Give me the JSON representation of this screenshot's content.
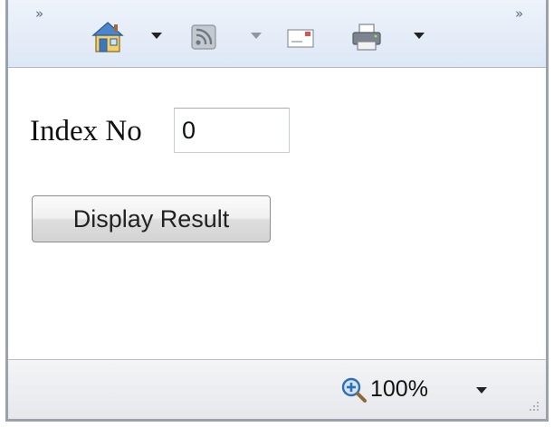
{
  "toolbar": {
    "chevron_left": "»",
    "chevron_right": "»",
    "buttons": [
      {
        "icon": "home-icon",
        "has_dropdown": true
      },
      {
        "icon": "rss-feed-icon",
        "has_dropdown": true
      },
      {
        "icon": "read-mail-icon",
        "has_dropdown": false
      },
      {
        "icon": "print-icon",
        "has_dropdown": true
      }
    ]
  },
  "form": {
    "index_label": "Index No",
    "index_value": "0",
    "display_button_label": "Display Result"
  },
  "statusbar": {
    "zoom_icon": "zoom-icon",
    "zoom_level": "100%"
  },
  "colors": {
    "toolbar_bg": "#dde7f5",
    "statusbar_bg": "#e6e8eb",
    "frame": "#9aa3ad"
  }
}
